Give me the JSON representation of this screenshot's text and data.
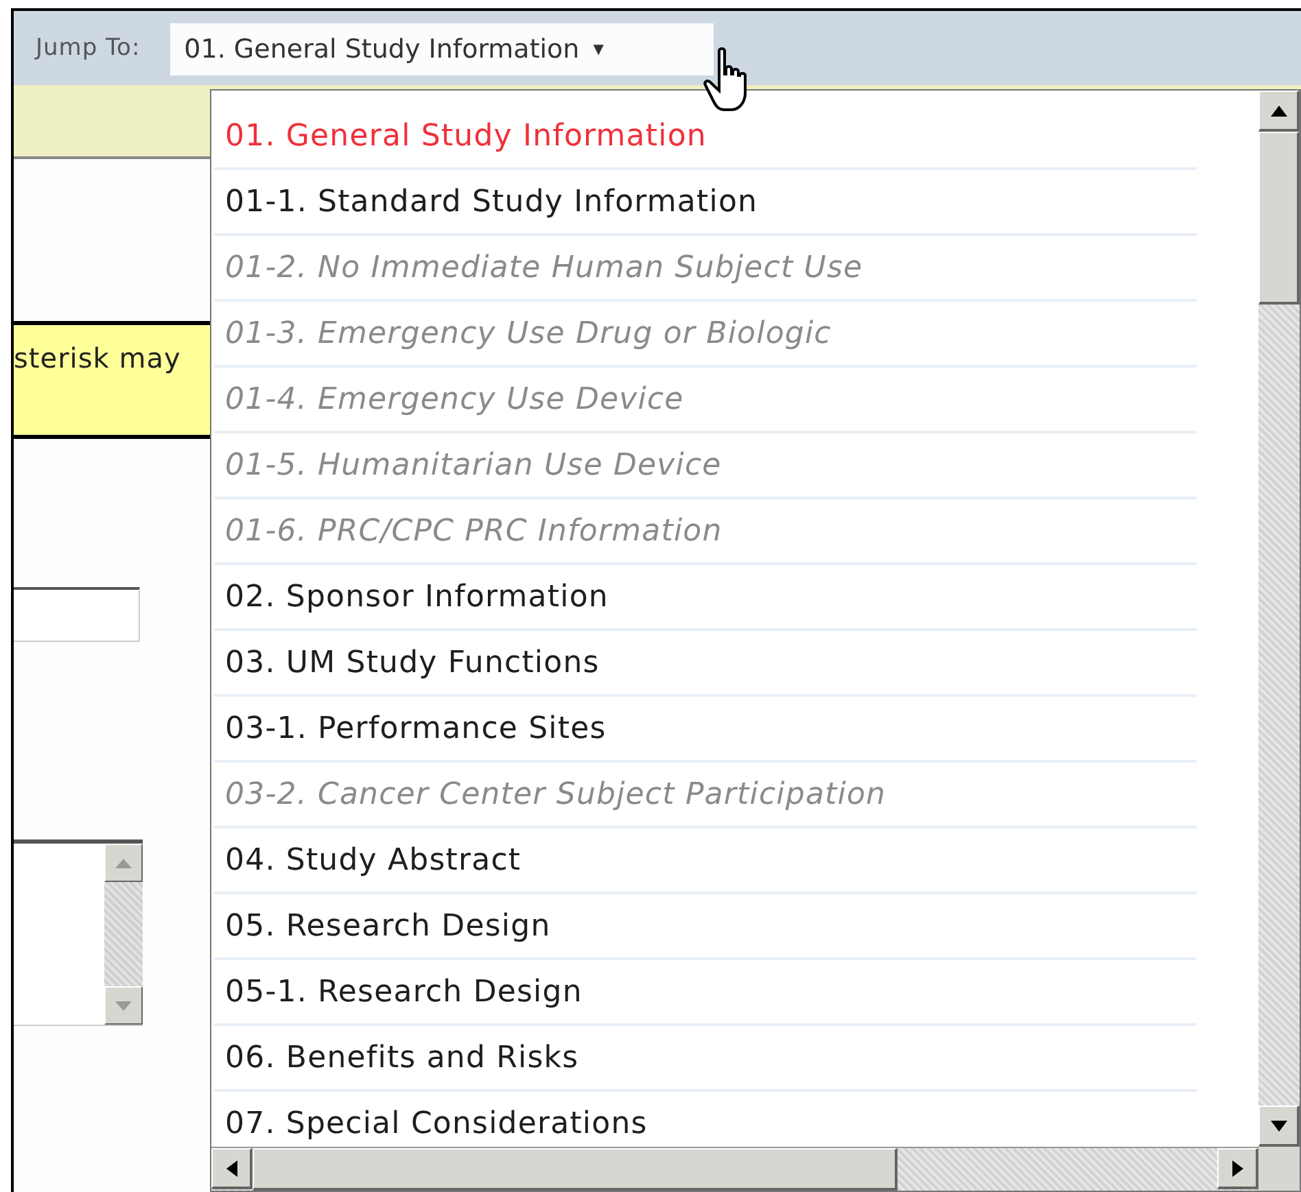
{
  "jump_to": {
    "label": "Jump To:",
    "value": "01. General Study Information",
    "caret": "▼"
  },
  "notice": {
    "text": "sterisk may"
  },
  "dropdown": {
    "items": [
      {
        "label": "01. General Study Information",
        "selected": true,
        "disabled": false
      },
      {
        "label": "01-1. Standard Study Information",
        "selected": false,
        "disabled": false
      },
      {
        "label": "01-2. No Immediate Human Subject Use",
        "selected": false,
        "disabled": true
      },
      {
        "label": "01-3. Emergency Use Drug or Biologic",
        "selected": false,
        "disabled": true
      },
      {
        "label": "01-4. Emergency Use Device",
        "selected": false,
        "disabled": true
      },
      {
        "label": "01-5. Humanitarian Use Device",
        "selected": false,
        "disabled": true
      },
      {
        "label": "01-6. PRC/CPC PRC Information",
        "selected": false,
        "disabled": true
      },
      {
        "label": "02. Sponsor Information",
        "selected": false,
        "disabled": false
      },
      {
        "label": "03. UM Study Functions",
        "selected": false,
        "disabled": false
      },
      {
        "label": "03-1. Performance Sites",
        "selected": false,
        "disabled": false
      },
      {
        "label": "03-2. Cancer Center Subject Participation",
        "selected": false,
        "disabled": true
      },
      {
        "label": "04. Study Abstract",
        "selected": false,
        "disabled": false
      },
      {
        "label": "05. Research Design",
        "selected": false,
        "disabled": false
      },
      {
        "label": "05-1. Research Design",
        "selected": false,
        "disabled": false
      },
      {
        "label": "06. Benefits and Risks",
        "selected": false,
        "disabled": false
      },
      {
        "label": "07. Special Considerations",
        "selected": false,
        "disabled": false
      }
    ]
  }
}
